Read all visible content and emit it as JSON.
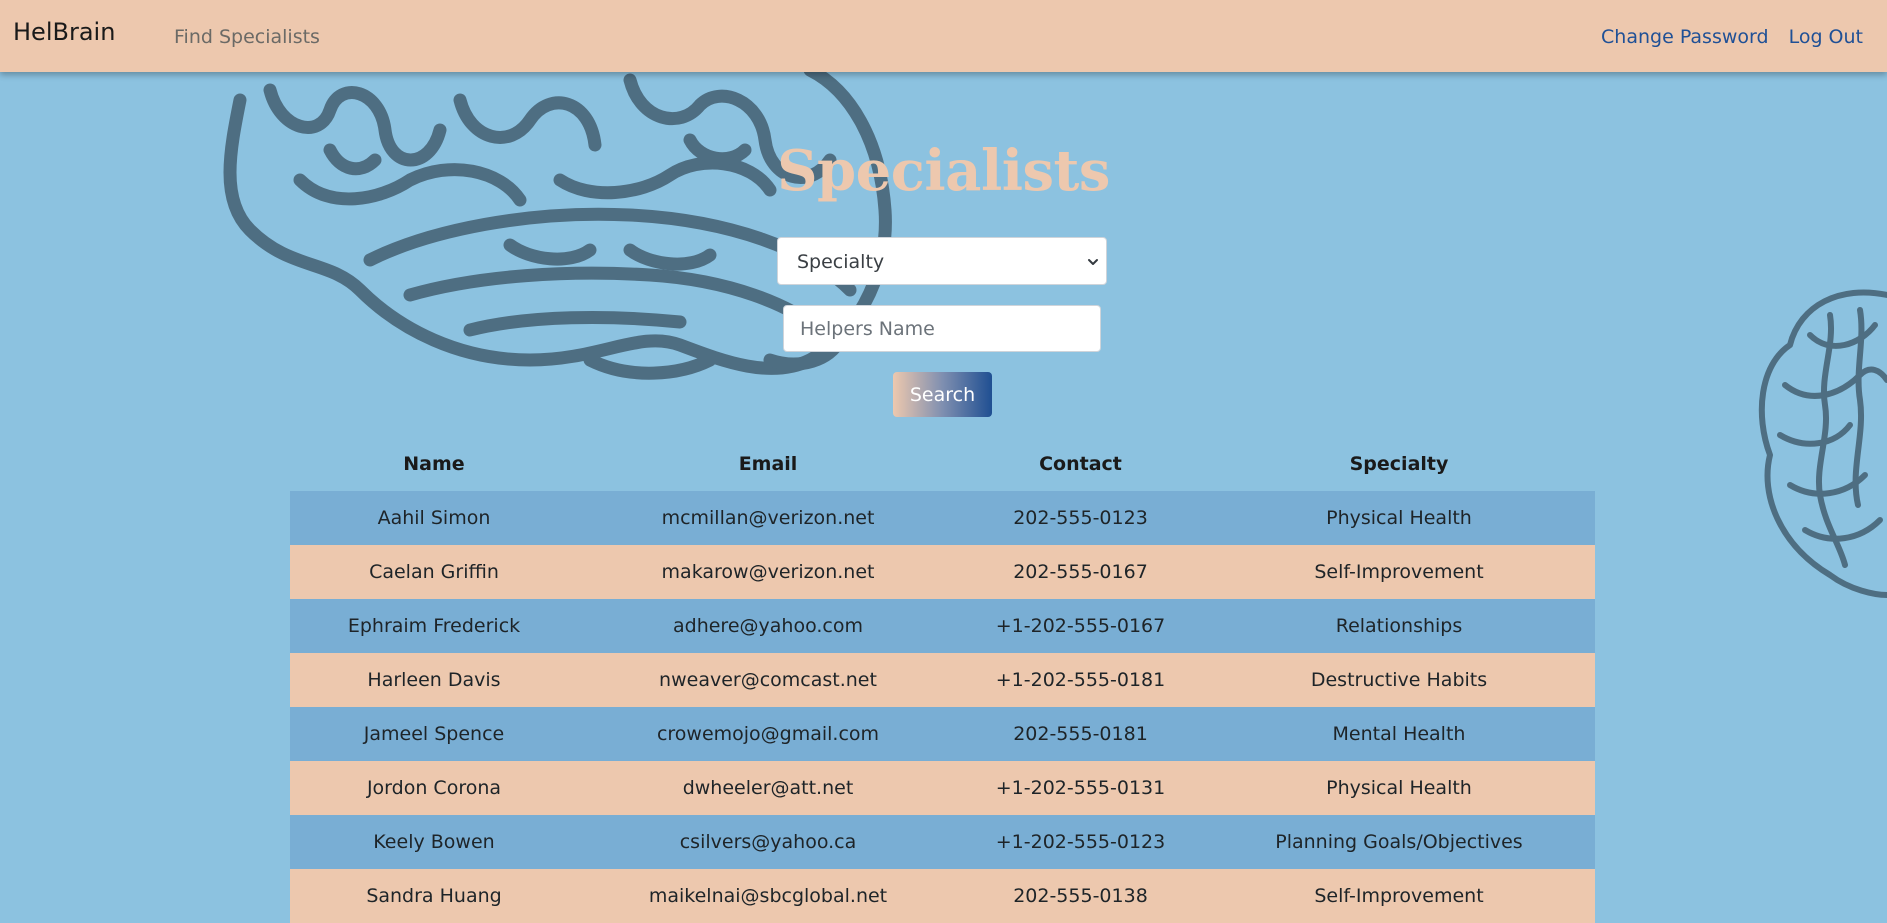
{
  "navbar": {
    "brand": "HelBrain",
    "find_link": "Find Specialists",
    "change_password": "Change Password",
    "logout": "Log Out"
  },
  "page": {
    "title": "Specialists"
  },
  "filters": {
    "specialty_selected": "Specialty",
    "name_placeholder": "Helpers Name",
    "search_label": "Search"
  },
  "table": {
    "headers": {
      "name": "Name",
      "email": "Email",
      "contact": "Contact",
      "specialty": "Specialty"
    },
    "rows": [
      {
        "name": "Aahil Simon",
        "email": "mcmillan@verizon.net",
        "contact": "202-555-0123",
        "specialty": "Physical Health"
      },
      {
        "name": "Caelan Griffin",
        "email": "makarow@verizon.net",
        "contact": "202-555-0167",
        "specialty": "Self-Improvement"
      },
      {
        "name": "Ephraim Frederick",
        "email": "adhere@yahoo.com",
        "contact": "+1-202-555-0167",
        "specialty": "Relationships"
      },
      {
        "name": "Harleen Davis",
        "email": "nweaver@comcast.net",
        "contact": "+1-202-555-0181",
        "specialty": "Destructive Habits"
      },
      {
        "name": "Jameel Spence",
        "email": "crowemojo@gmail.com",
        "contact": "202-555-0181",
        "specialty": "Mental Health"
      },
      {
        "name": "Jordon Corona",
        "email": "dwheeler@att.net",
        "contact": "+1-202-555-0131",
        "specialty": "Physical Health"
      },
      {
        "name": "Keely Bowen",
        "email": "csilvers@yahoo.ca",
        "contact": "+1-202-555-0123",
        "specialty": "Planning Goals/Objectives"
      },
      {
        "name": "Sandra Huang",
        "email": "maikelnai@sbcglobal.net",
        "contact": "202-555-0138",
        "specialty": "Self-Improvement"
      }
    ]
  },
  "colors": {
    "background": "#8cc2e0",
    "navbar": "#edc8ae",
    "row_blue": "#79aed4",
    "row_peach": "#edc8ae",
    "brain_outline": "#4e6e82",
    "link": "#1f5096"
  }
}
